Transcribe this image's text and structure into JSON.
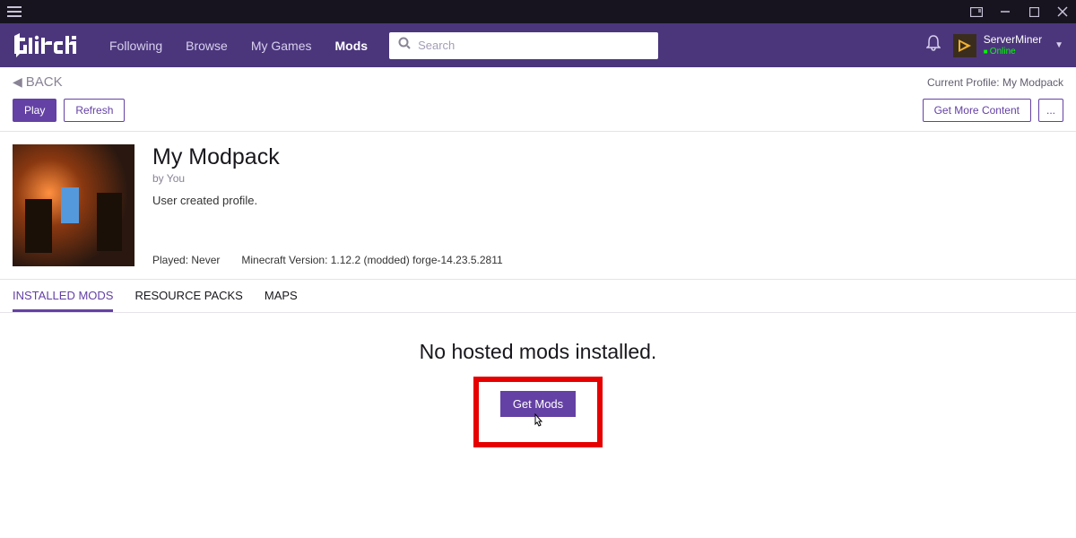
{
  "nav": {
    "following": "Following",
    "browse": "Browse",
    "mygames": "My Games",
    "mods": "Mods"
  },
  "search": {
    "placeholder": "Search"
  },
  "user": {
    "name": "ServerMiner",
    "status": "Online"
  },
  "back": "BACK",
  "currentProfile": "Current Profile: My Modpack",
  "buttons": {
    "play": "Play",
    "refresh": "Refresh",
    "getMoreContent": "Get More Content",
    "more": "...",
    "getMods": "Get Mods"
  },
  "profile": {
    "title": "My Modpack",
    "author": "by You",
    "desc": "User created profile.",
    "played": "Played: Never",
    "version": "Minecraft Version: 1.12.2 (modded) forge-14.23.5.2811"
  },
  "tabs": {
    "installed": "INSTALLED MODS",
    "resource": "RESOURCE PACKS",
    "maps": "MAPS"
  },
  "empty": "No hosted mods installed."
}
